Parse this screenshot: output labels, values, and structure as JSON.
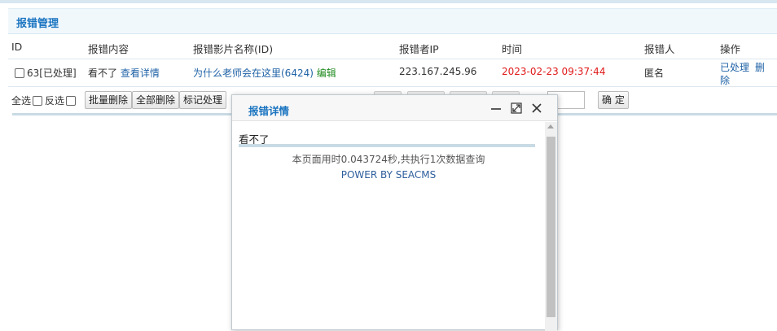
{
  "panel": {
    "title": "报错管理"
  },
  "table": {
    "headers": [
      "ID",
      "报错内容",
      "报错影片名称(ID)",
      "报错者IP",
      "时间",
      "报错人",
      "操作"
    ],
    "row": {
      "id": "63",
      "status": "[已处理]",
      "content": "看不了",
      "view_details": "查看详情",
      "movie": "为什么老师会在这里(6424)",
      "edit": "编辑",
      "ip": "223.167.245.96",
      "time": "2023-02-23 09:37:44",
      "reporter": "匿名",
      "action_processed": "已处理",
      "action_delete": "删",
      "action_delete2": "除"
    }
  },
  "toolbar": {
    "select_all": "全选",
    "invert": "反选",
    "batch_delete": "批量删除",
    "delete_all": "全部删除",
    "mark_processed": "标记处理",
    "confirm": "确 定"
  },
  "modal": {
    "title": "报错详情",
    "message": "看不了",
    "footer_stats": "本页面用时0.043724秒,共执行1次数据查询",
    "footer_power": "POWER BY SEACMS"
  }
}
